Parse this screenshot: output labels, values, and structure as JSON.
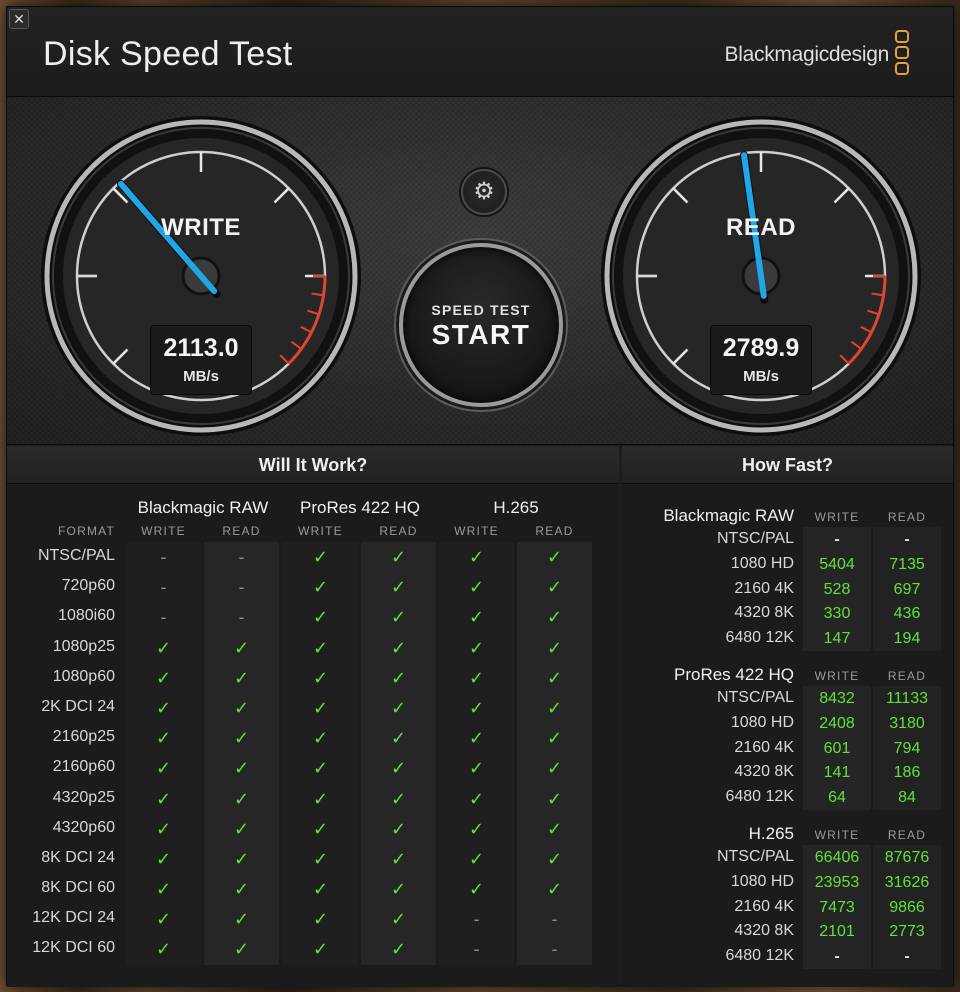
{
  "app": {
    "title": "Disk Speed Test",
    "brand": "Blackmagicdesign",
    "close_symbol": "✕"
  },
  "gauges": {
    "write": {
      "label": "WRITE",
      "value": "2113.0",
      "unit": "MB/s"
    },
    "read": {
      "label": "READ",
      "value": "2789.9",
      "unit": "MB/s"
    }
  },
  "controls": {
    "settings_icon": "gear-icon",
    "settings_symbol": "⚙",
    "start_small": "SPEED TEST",
    "start_big": "START"
  },
  "will_it_work": {
    "title": "Will It Work?",
    "format_header": "FORMAT",
    "groups": [
      "Blackmagic RAW",
      "ProRes 422 HQ",
      "H.265"
    ],
    "sub_headers": [
      "WRITE",
      "READ"
    ],
    "rows": [
      {
        "format": "NTSC/PAL",
        "cells": [
          "-",
          "-",
          "✓",
          "✓",
          "✓",
          "✓"
        ]
      },
      {
        "format": "720p60",
        "cells": [
          "-",
          "-",
          "✓",
          "✓",
          "✓",
          "✓"
        ]
      },
      {
        "format": "1080i60",
        "cells": [
          "-",
          "-",
          "✓",
          "✓",
          "✓",
          "✓"
        ]
      },
      {
        "format": "1080p25",
        "cells": [
          "✓",
          "✓",
          "✓",
          "✓",
          "✓",
          "✓"
        ]
      },
      {
        "format": "1080p60",
        "cells": [
          "✓",
          "✓",
          "✓",
          "✓",
          "✓",
          "✓"
        ]
      },
      {
        "format": "2K DCI 24",
        "cells": [
          "✓",
          "✓",
          "✓",
          "✓",
          "✓",
          "✓"
        ]
      },
      {
        "format": "2160p25",
        "cells": [
          "✓",
          "✓",
          "✓",
          "✓",
          "✓",
          "✓"
        ]
      },
      {
        "format": "2160p60",
        "cells": [
          "✓",
          "✓",
          "✓",
          "✓",
          "✓",
          "✓"
        ]
      },
      {
        "format": "4320p25",
        "cells": [
          "✓",
          "✓",
          "✓",
          "✓",
          "✓",
          "✓"
        ]
      },
      {
        "format": "4320p60",
        "cells": [
          "✓",
          "✓",
          "✓",
          "✓",
          "✓",
          "✓"
        ]
      },
      {
        "format": "8K DCI 24",
        "cells": [
          "✓",
          "✓",
          "✓",
          "✓",
          "✓",
          "✓"
        ]
      },
      {
        "format": "8K DCI 60",
        "cells": [
          "✓",
          "✓",
          "✓",
          "✓",
          "✓",
          "✓"
        ]
      },
      {
        "format": "12K DCI 24",
        "cells": [
          "✓",
          "✓",
          "✓",
          "✓",
          "-",
          "-"
        ]
      },
      {
        "format": "12K DCI 60",
        "cells": [
          "✓",
          "✓",
          "✓",
          "✓",
          "-",
          "-"
        ]
      }
    ]
  },
  "how_fast": {
    "title": "How Fast?",
    "col_write": "WRITE",
    "col_read": "READ",
    "blocks": [
      {
        "codec": "Blackmagic RAW",
        "rows": [
          {
            "format": "NTSC/PAL",
            "write": "-",
            "read": "-"
          },
          {
            "format": "1080 HD",
            "write": "5404",
            "read": "7135"
          },
          {
            "format": "2160 4K",
            "write": "528",
            "read": "697"
          },
          {
            "format": "4320 8K",
            "write": "330",
            "read": "436"
          },
          {
            "format": "6480 12K",
            "write": "147",
            "read": "194"
          }
        ]
      },
      {
        "codec": "ProRes 422 HQ",
        "rows": [
          {
            "format": "NTSC/PAL",
            "write": "8432",
            "read": "11133"
          },
          {
            "format": "1080 HD",
            "write": "2408",
            "read": "3180"
          },
          {
            "format": "2160 4K",
            "write": "601",
            "read": "794"
          },
          {
            "format": "4320 8K",
            "write": "141",
            "read": "186"
          },
          {
            "format": "6480 12K",
            "write": "64",
            "read": "84"
          }
        ]
      },
      {
        "codec": "H.265",
        "rows": [
          {
            "format": "NTSC/PAL",
            "write": "66406",
            "read": "87676"
          },
          {
            "format": "1080 HD",
            "write": "23953",
            "read": "31626"
          },
          {
            "format": "2160 4K",
            "write": "7473",
            "read": "9866"
          },
          {
            "format": "4320 8K",
            "write": "2101",
            "read": "2773"
          },
          {
            "format": "6480 12K",
            "write": "-",
            "read": "-"
          }
        ]
      }
    ]
  },
  "colors": {
    "check": "#5fe23a",
    "needle": "#1ea6e8",
    "redline": "#e0452e",
    "brand_accent": "#e8a03a"
  }
}
